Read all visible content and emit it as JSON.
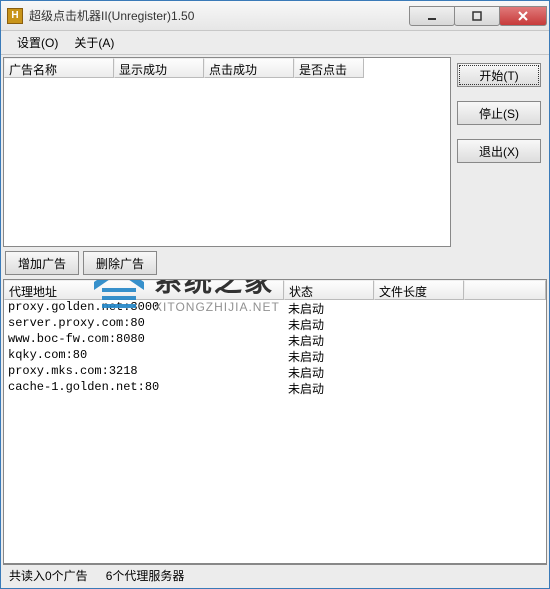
{
  "title": "超级点击机器II(Unregister)1.50",
  "menu": {
    "settings": "设置(O)",
    "about": "关于(A)"
  },
  "table1": {
    "headers": [
      "广告名称",
      "显示成功",
      "点击成功",
      "是否点击"
    ],
    "widths": [
      110,
      90,
      90,
      70
    ]
  },
  "sidebuttons": {
    "start": "开始(T)",
    "stop": "停止(S)",
    "exit": "退出(X)"
  },
  "midbuttons": {
    "add": "增加广告",
    "del": "删除广告"
  },
  "table2": {
    "headers": [
      "代理地址",
      "状态",
      "文件长度"
    ],
    "widths": [
      280,
      90,
      90
    ],
    "rows": [
      {
        "addr": "proxy.golden.net:3000",
        "status": "未启动",
        "len": ""
      },
      {
        "addr": "server.proxy.com:80",
        "status": "未启动",
        "len": ""
      },
      {
        "addr": "www.boc-fw.com:8080",
        "status": "未启动",
        "len": ""
      },
      {
        "addr": "kqky.com:80",
        "status": "未启动",
        "len": ""
      },
      {
        "addr": "proxy.mks.com:3218",
        "status": "未启动",
        "len": ""
      },
      {
        "addr": "cache-1.golden.net:80",
        "status": "未启动",
        "len": ""
      }
    ]
  },
  "status": {
    "left": "共读入0个广告",
    "right": "6个代理服务器"
  },
  "watermark": {
    "line1": "系统之家",
    "line2": "XITONGZHIJIA.NET"
  }
}
